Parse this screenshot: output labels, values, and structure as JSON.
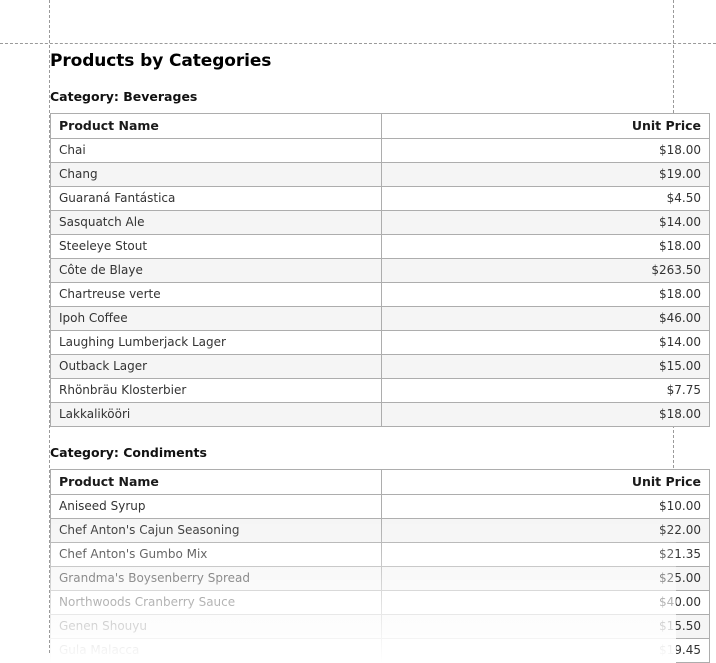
{
  "report": {
    "title": "Products by Categories",
    "columns": {
      "product_name": "Product Name",
      "unit_price": "Unit Price"
    },
    "sections": [
      {
        "heading": "Category: Beverages",
        "category": "Beverages",
        "rows": [
          {
            "name": "Chai",
            "price": "$18.00"
          },
          {
            "name": "Chang",
            "price": "$19.00"
          },
          {
            "name": "Guaraná Fantástica",
            "price": "$4.50"
          },
          {
            "name": "Sasquatch Ale",
            "price": "$14.00"
          },
          {
            "name": "Steeleye Stout",
            "price": "$18.00"
          },
          {
            "name": "Côte de Blaye",
            "price": "$263.50"
          },
          {
            "name": "Chartreuse verte",
            "price": "$18.00"
          },
          {
            "name": "Ipoh Coffee",
            "price": "$46.00"
          },
          {
            "name": "Laughing Lumberjack Lager",
            "price": "$14.00"
          },
          {
            "name": "Outback Lager",
            "price": "$15.00"
          },
          {
            "name": "Rhönbräu Klosterbier",
            "price": "$7.75"
          },
          {
            "name": "Lakkalikööri",
            "price": "$18.00"
          }
        ]
      },
      {
        "heading": "Category: Condiments",
        "category": "Condiments",
        "rows": [
          {
            "name": "Aniseed Syrup",
            "price": "$10.00"
          },
          {
            "name": "Chef Anton's Cajun Seasoning",
            "price": "$22.00"
          },
          {
            "name": "Chef Anton's Gumbo Mix",
            "price": "$21.35"
          },
          {
            "name": "Grandma's Boysenberry Spread",
            "price": "$25.00"
          },
          {
            "name": "Northwoods Cranberry Sauce",
            "price": "$40.00"
          },
          {
            "name": "Genen Shouyu",
            "price": "$15.50"
          },
          {
            "name": "Gula Malacca",
            "price": "$19.45"
          }
        ]
      }
    ]
  },
  "colors": {
    "text": "#333333",
    "heading": "#111111",
    "border": "#adadad",
    "row_alt": "#f5f5f5",
    "guide": "#9a9a9a",
    "page_background": "#ffffff"
  }
}
